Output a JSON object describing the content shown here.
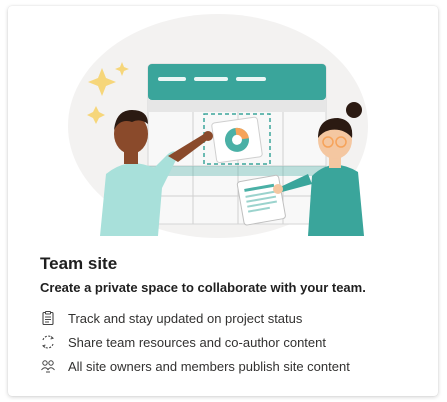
{
  "card": {
    "title": "Team site",
    "subtitle": "Create a private space to collaborate with your team.",
    "features": [
      {
        "icon": "clipboard-icon",
        "label": "Track and stay updated on project status"
      },
      {
        "icon": "sync-icon",
        "label": "Share team resources and co-author content"
      },
      {
        "icon": "people-icon",
        "label": "All site owners and members publish site content"
      }
    ]
  },
  "colors": {
    "accent": "#4ab0a6",
    "header_teal": "#3aa59b",
    "star_yellow": "#f6d67a",
    "skin_dark": "#8a4a2b",
    "skin_light": "#f4c7a1",
    "text": "#1f1f1f"
  }
}
